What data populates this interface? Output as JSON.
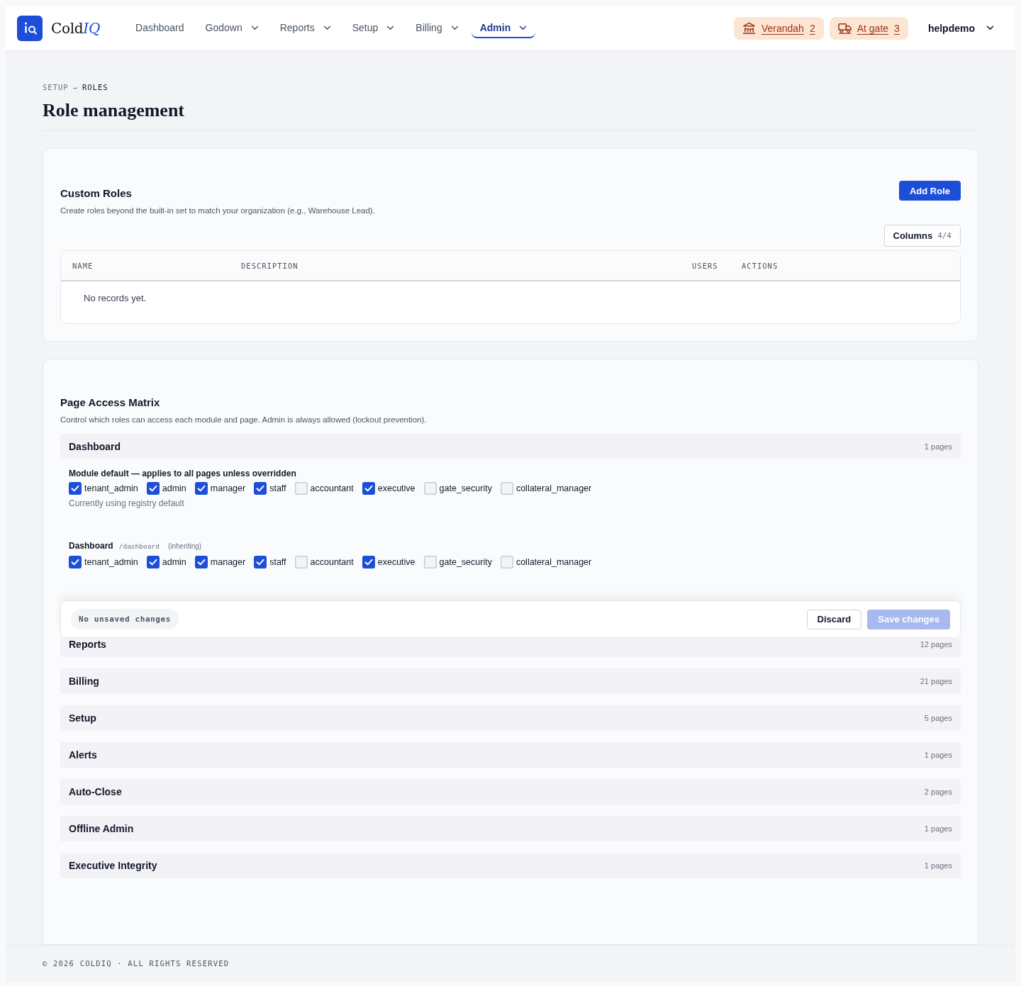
{
  "header": {
    "brand": {
      "name": "Cold",
      "accent": "IQ"
    },
    "nav": [
      {
        "label": "Dashboard",
        "has_menu": false,
        "selected": false
      },
      {
        "label": "Godown",
        "has_menu": true,
        "selected": false
      },
      {
        "label": "Reports",
        "has_menu": true,
        "selected": false
      },
      {
        "label": "Setup",
        "has_menu": true,
        "selected": false
      },
      {
        "label": "Billing",
        "has_menu": true,
        "selected": false
      },
      {
        "label": "Admin",
        "has_menu": true,
        "selected": true
      }
    ],
    "badges": [
      {
        "kind": "verandah",
        "label": "Verandah",
        "count": "2"
      },
      {
        "kind": "gate",
        "label": "At gate",
        "count": "3"
      }
    ],
    "user": "helpdemo"
  },
  "breadcrumb": {
    "items": [
      "SETUP",
      "ROLES"
    ],
    "separator": "→"
  },
  "title": "Role management",
  "custom_roles": {
    "title": "Custom Roles",
    "description": "Create roles beyond the built-in set to match your organization (e.g., Warehouse Lead).",
    "add_button": "Add Role",
    "columns_button": {
      "label": "Columns",
      "count": "4/4"
    },
    "table": {
      "columns": [
        "NAME",
        "DESCRIPTION",
        "USERS",
        "ACTIONS"
      ],
      "empty_text": "No records yet."
    }
  },
  "matrix": {
    "title": "Page Access Matrix",
    "description": "Control which roles can access each module and page. Admin is always allowed (lockout prevention).",
    "modules": [
      {
        "name": "Dashboard",
        "pages_count": "1 pages",
        "module_default": {
          "title": "Module default — applies to all pages unless overridden",
          "roles": [
            {
              "label": "tenant_admin",
              "checked": true
            },
            {
              "label": "admin",
              "checked": true
            },
            {
              "label": "manager",
              "checked": true
            },
            {
              "label": "staff",
              "checked": true
            },
            {
              "label": "accountant",
              "checked": false
            },
            {
              "label": "executive",
              "checked": true
            },
            {
              "label": "gate_security",
              "checked": false
            },
            {
              "label": "collateral_manager",
              "checked": false
            }
          ],
          "note": "Currently using registry default"
        },
        "pages": [
          {
            "name": "Dashboard",
            "path": "/dashboard",
            "status": "(inheriting)",
            "roles": [
              {
                "label": "tenant_admin",
                "checked": true
              },
              {
                "label": "admin",
                "checked": true
              },
              {
                "label": "manager",
                "checked": true
              },
              {
                "label": "staff",
                "checked": true
              },
              {
                "label": "accountant",
                "checked": false
              },
              {
                "label": "executive",
                "checked": true
              },
              {
                "label": "gate_security",
                "checked": false
              },
              {
                "label": "collateral_manager",
                "checked": false
              }
            ]
          }
        ]
      },
      {
        "name": "Reports",
        "pages_count": "12 pages"
      },
      {
        "name": "Billing",
        "pages_count": "21 pages"
      },
      {
        "name": "Setup",
        "pages_count": "5 pages"
      },
      {
        "name": "Alerts",
        "pages_count": "1 pages"
      },
      {
        "name": "Auto-Close",
        "pages_count": "2 pages"
      },
      {
        "name": "Offline Admin",
        "pages_count": "1 pages"
      },
      {
        "name": "Executive Integrity",
        "pages_count": "1 pages"
      }
    ]
  },
  "save_bar": {
    "status": "No unsaved changes",
    "discard": "Discard",
    "save": {
      "label": "Save changes",
      "disabled": true
    }
  },
  "footer": "© 2026 COLDIQ · ALL RIGHTS RESERVED"
}
